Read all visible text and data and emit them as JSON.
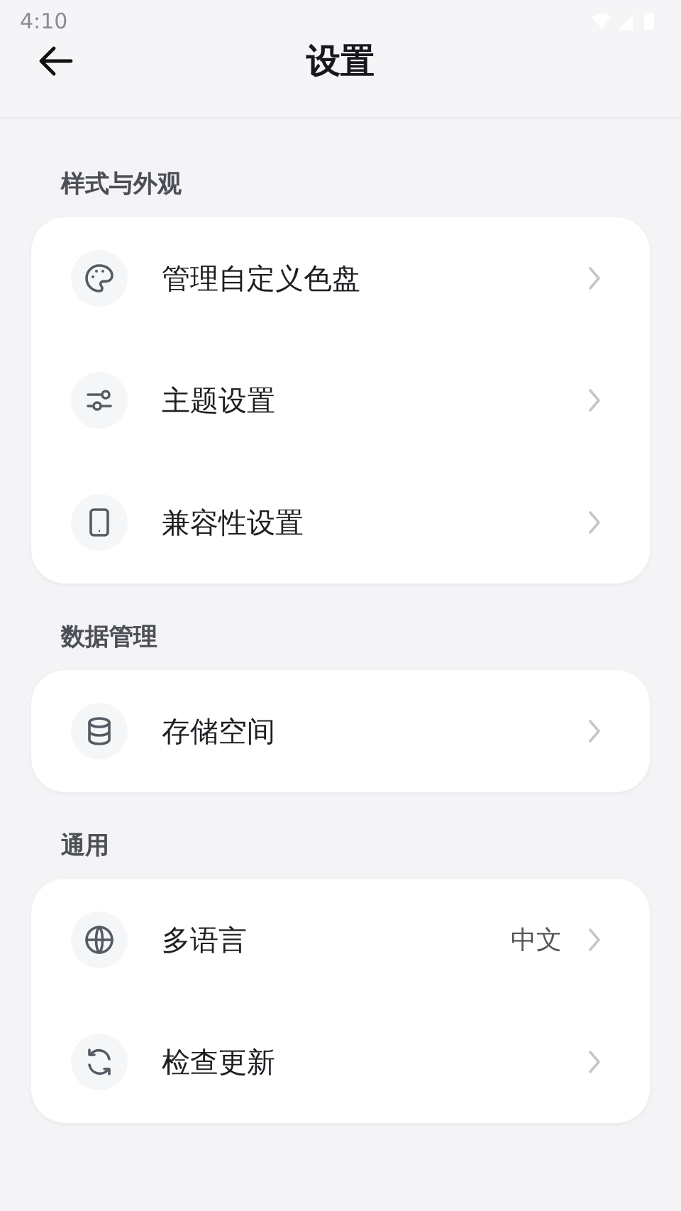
{
  "status_bar": {
    "time": "4:10"
  },
  "header": {
    "title": "设置"
  },
  "sections": [
    {
      "title": "样式与外观",
      "items": [
        {
          "label": "管理自定义色盘"
        },
        {
          "label": "主题设置"
        },
        {
          "label": "兼容性设置"
        }
      ]
    },
    {
      "title": "数据管理",
      "items": [
        {
          "label": "存储空间"
        }
      ]
    },
    {
      "title": "通用",
      "items": [
        {
          "label": "多语言",
          "value": "中文"
        },
        {
          "label": "检查更新"
        }
      ]
    }
  ]
}
